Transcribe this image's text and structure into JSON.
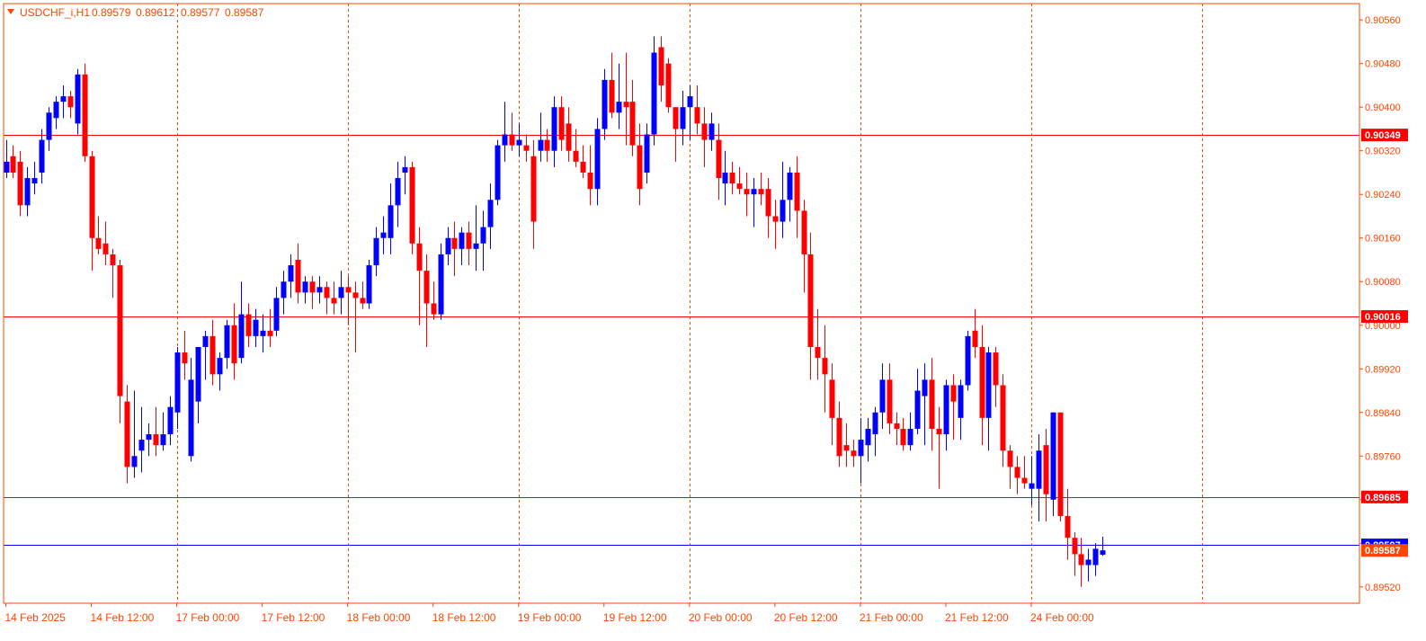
{
  "chart_data": {
    "type": "candlestick",
    "header": {
      "symbol_timeframe": "USDCHF_i,H1",
      "open": "0.89579",
      "high": "0.89612",
      "low": "0.89577",
      "close": "0.89587"
    },
    "ylim": [
      0.8949,
      0.9059
    ],
    "y_ticks": [
      "0.90560",
      "0.90480",
      "0.90400",
      "0.90320",
      "0.90240",
      "0.90160",
      "0.90080",
      "0.90000",
      "0.89920",
      "0.89840",
      "0.89760",
      "0.89680",
      "0.89600",
      "0.89520"
    ],
    "x_ticks": [
      {
        "label": "14 Feb 2025",
        "bar": 0
      },
      {
        "label": "14 Feb 12:00",
        "bar": 12
      },
      {
        "label": "17 Feb 00:00",
        "bar": 24
      },
      {
        "label": "17 Feb 12:00",
        "bar": 36
      },
      {
        "label": "18 Feb 00:00",
        "bar": 48
      },
      {
        "label": "18 Feb 12:00",
        "bar": 60
      },
      {
        "label": "19 Feb 00:00",
        "bar": 72
      },
      {
        "label": "19 Feb 12:00",
        "bar": 84
      },
      {
        "label": "20 Feb 00:00",
        "bar": 96
      },
      {
        "label": "20 Feb 12:00",
        "bar": 108
      },
      {
        "label": "21 Feb 00:00",
        "bar": 120
      },
      {
        "label": "21 Feb 12:00",
        "bar": 132
      },
      {
        "label": "24 Feb 00:00",
        "bar": 144
      }
    ],
    "period_separators": [
      24,
      48,
      72,
      96,
      120,
      144,
      168
    ],
    "horizontal_levels": [
      {
        "value": 0.90349,
        "label": "0.90349",
        "color": "#ff0000"
      },
      {
        "value": 0.90016,
        "label": "0.90016",
        "color": "#ff0000"
      },
      {
        "value": 0.89685,
        "label": "0.89685",
        "color": "#ff0000"
      }
    ],
    "bid_line": {
      "value": 0.89597,
      "label": "0.89597",
      "color": "#0000ff"
    },
    "current_price": {
      "value": 0.89587,
      "label": "0.89587",
      "color": "#ff4500"
    },
    "colors": {
      "bull": "#0000ff",
      "bear": "#ff0000",
      "grid": "#ff4500",
      "axis_text": "#ff4500",
      "frame": "#ff4500",
      "background": "#ffffff"
    },
    "candles": [
      [
        0.9028,
        0.9034,
        0.9027,
        0.903
      ],
      [
        0.9031,
        0.9033,
        0.9027,
        0.9028
      ],
      [
        0.903,
        0.9032,
        0.902,
        0.9022
      ],
      [
        0.9022,
        0.9029,
        0.902,
        0.9027
      ],
      [
        0.9026,
        0.903,
        0.9024,
        0.9027
      ],
      [
        0.9028,
        0.9036,
        0.9026,
        0.9034
      ],
      [
        0.9034,
        0.904,
        0.9032,
        0.9039
      ],
      [
        0.9038,
        0.9042,
        0.9036,
        0.9041
      ],
      [
        0.9041,
        0.9044,
        0.9038,
        0.9042
      ],
      [
        0.9042,
        0.9043,
        0.9038,
        0.904
      ],
      [
        0.9037,
        0.9047,
        0.9035,
        0.9046
      ],
      [
        0.9046,
        0.9048,
        0.903,
        0.9031
      ],
      [
        0.9031,
        0.9032,
        0.901,
        0.9016
      ],
      [
        0.9016,
        0.902,
        0.9013,
        0.9014
      ],
      [
        0.9015,
        0.9019,
        0.9011,
        0.9013
      ],
      [
        0.9013,
        0.9014,
        0.9005,
        0.9011
      ],
      [
        0.9011,
        0.9012,
        0.8982,
        0.8987
      ],
      [
        0.8986,
        0.8989,
        0.8971,
        0.8974
      ],
      [
        0.8974,
        0.8988,
        0.8972,
        0.8976
      ],
      [
        0.8977,
        0.8985,
        0.8973,
        0.8979
      ],
      [
        0.8979,
        0.8982,
        0.8976,
        0.898
      ],
      [
        0.898,
        0.8985,
        0.8976,
        0.8978
      ],
      [
        0.8978,
        0.8984,
        0.8977,
        0.898
      ],
      [
        0.898,
        0.8987,
        0.8978,
        0.8985
      ],
      [
        0.8984,
        0.8996,
        0.8981,
        0.8995
      ],
      [
        0.8995,
        0.8999,
        0.899,
        0.8993
      ],
      [
        0.8976,
        0.8994,
        0.8975,
        0.899
      ],
      [
        0.8986,
        0.8994,
        0.8982,
        0.8996
      ],
      [
        0.8996,
        0.8999,
        0.899,
        0.8998
      ],
      [
        0.8998,
        0.9001,
        0.8989,
        0.8991
      ],
      [
        0.8991,
        0.8995,
        0.8988,
        0.8994
      ],
      [
        0.8994,
        0.9001,
        0.8992,
        0.9
      ],
      [
        0.9,
        0.9004,
        0.899,
        0.8993
      ],
      [
        0.8994,
        0.9008,
        0.8993,
        0.9002
      ],
      [
        0.9002,
        0.9004,
        0.8996,
        0.8998
      ],
      [
        0.8998,
        0.9003,
        0.8996,
        0.9001
      ],
      [
        0.8998,
        0.9002,
        0.8995,
        0.8999
      ],
      [
        0.8999,
        0.9003,
        0.8996,
        0.8998
      ],
      [
        0.8999,
        0.9007,
        0.8998,
        0.9005
      ],
      [
        0.9005,
        0.901,
        0.9002,
        0.9008
      ],
      [
        0.9008,
        0.9013,
        0.9005,
        0.9011
      ],
      [
        0.9012,
        0.9015,
        0.9004,
        0.9006
      ],
      [
        0.9006,
        0.9009,
        0.9004,
        0.9008
      ],
      [
        0.9008,
        0.9009,
        0.9003,
        0.9006
      ],
      [
        0.9006,
        0.9009,
        0.9004,
        0.9007
      ],
      [
        0.9007,
        0.9008,
        0.9002,
        0.9005
      ],
      [
        0.9005,
        0.9008,
        0.9002,
        0.9004
      ],
      [
        0.9005,
        0.901,
        0.9002,
        0.9007
      ],
      [
        0.9007,
        0.9009,
        0.9,
        0.9006
      ],
      [
        0.9006,
        0.9008,
        0.8995,
        0.9005
      ],
      [
        0.9005,
        0.9008,
        0.9003,
        0.9004
      ],
      [
        0.9004,
        0.9012,
        0.9003,
        0.9011
      ],
      [
        0.9011,
        0.9018,
        0.9009,
        0.9016
      ],
      [
        0.9016,
        0.902,
        0.9013,
        0.9017
      ],
      [
        0.9016,
        0.9026,
        0.9013,
        0.9022
      ],
      [
        0.9022,
        0.903,
        0.9018,
        0.9027
      ],
      [
        0.9028,
        0.9031,
        0.9024,
        0.9029
      ],
      [
        0.9029,
        0.903,
        0.9013,
        0.9015
      ],
      [
        0.9015,
        0.9018,
        0.9,
        0.901
      ],
      [
        0.901,
        0.9013,
        0.8996,
        0.9004
      ],
      [
        0.9004,
        0.9008,
        0.9001,
        0.9002
      ],
      [
        0.9002,
        0.9015,
        0.9001,
        0.9013
      ],
      [
        0.9013,
        0.9018,
        0.9011,
        0.9016
      ],
      [
        0.9016,
        0.9019,
        0.9009,
        0.9014
      ],
      [
        0.9014,
        0.9018,
        0.9011,
        0.9017
      ],
      [
        0.9017,
        0.9019,
        0.9011,
        0.9014
      ],
      [
        0.9014,
        0.9022,
        0.901,
        0.9015
      ],
      [
        0.9015,
        0.9021,
        0.901,
        0.9018
      ],
      [
        0.9018,
        0.9026,
        0.9014,
        0.9023
      ],
      [
        0.9023,
        0.9034,
        0.9022,
        0.9033
      ],
      [
        0.9033,
        0.9041,
        0.903,
        0.9035
      ],
      [
        0.9035,
        0.9039,
        0.9032,
        0.9033
      ],
      [
        0.9033,
        0.9037,
        0.9031,
        0.9034
      ],
      [
        0.9033,
        0.9035,
        0.903,
        0.9032
      ],
      [
        0.9031,
        0.9034,
        0.9014,
        0.9019
      ],
      [
        0.9032,
        0.9039,
        0.903,
        0.9034
      ],
      [
        0.9034,
        0.9036,
        0.903,
        0.9032
      ],
      [
        0.9032,
        0.9042,
        0.9029,
        0.904
      ],
      [
        0.904,
        0.9042,
        0.9032,
        0.9034
      ],
      [
        0.9037,
        0.904,
        0.903,
        0.9032
      ],
      [
        0.9032,
        0.9036,
        0.9029,
        0.903
      ],
      [
        0.903,
        0.9033,
        0.9027,
        0.9028
      ],
      [
        0.9028,
        0.9033,
        0.9022,
        0.9025
      ],
      [
        0.9025,
        0.9038,
        0.9022,
        0.9036
      ],
      [
        0.9036,
        0.9047,
        0.9034,
        0.9045
      ],
      [
        0.9045,
        0.905,
        0.9038,
        0.9039
      ],
      [
        0.9039,
        0.9048,
        0.9036,
        0.9041
      ],
      [
        0.9041,
        0.905,
        0.9033,
        0.904
      ],
      [
        0.9041,
        0.9045,
        0.9031,
        0.9033
      ],
      [
        0.9033,
        0.9037,
        0.9022,
        0.9025
      ],
      [
        0.9028,
        0.9037,
        0.9026,
        0.9035
      ],
      [
        0.9035,
        0.9053,
        0.9033,
        0.905
      ],
      [
        0.9051,
        0.9053,
        0.9041,
        0.9044
      ],
      [
        0.9048,
        0.9049,
        0.9039,
        0.904
      ],
      [
        0.904,
        0.9039,
        0.903,
        0.9036
      ],
      [
        0.9036,
        0.9043,
        0.9033,
        0.904
      ],
      [
        0.904,
        0.9044,
        0.9034,
        0.9042
      ],
      [
        0.904,
        0.9044,
        0.9035,
        0.9037
      ],
      [
        0.9037,
        0.904,
        0.9029,
        0.9034
      ],
      [
        0.9034,
        0.9039,
        0.9032,
        0.9037
      ],
      [
        0.9034,
        0.9037,
        0.9023,
        0.9027
      ],
      [
        0.9026,
        0.9032,
        0.9022,
        0.9028
      ],
      [
        0.9028,
        0.903,
        0.9024,
        0.9026
      ],
      [
        0.9026,
        0.9029,
        0.9024,
        0.9025
      ],
      [
        0.9025,
        0.9028,
        0.902,
        0.9024
      ],
      [
        0.9024,
        0.9027,
        0.9018,
        0.9025
      ],
      [
        0.9025,
        0.9028,
        0.9022,
        0.9024
      ],
      [
        0.9025,
        0.9027,
        0.9016,
        0.902
      ],
      [
        0.902,
        0.9023,
        0.9014,
        0.9019
      ],
      [
        0.9019,
        0.903,
        0.9016,
        0.9023
      ],
      [
        0.9023,
        0.9029,
        0.9019,
        0.9028
      ],
      [
        0.9028,
        0.9031,
        0.9016,
        0.9021
      ],
      [
        0.9021,
        0.9023,
        0.9006,
        0.9013
      ],
      [
        0.9013,
        0.9017,
        0.899,
        0.8996
      ],
      [
        0.8996,
        0.9003,
        0.899,
        0.8994
      ],
      [
        0.8994,
        0.9,
        0.8984,
        0.8991
      ],
      [
        0.899,
        0.8993,
        0.8978,
        0.8983
      ],
      [
        0.8983,
        0.8986,
        0.8974,
        0.8976
      ],
      [
        0.8978,
        0.8982,
        0.8974,
        0.8977
      ],
      [
        0.8977,
        0.8979,
        0.8974,
        0.8976
      ],
      [
        0.8976,
        0.8983,
        0.8971,
        0.8979
      ],
      [
        0.8978,
        0.8983,
        0.8975,
        0.8981
      ],
      [
        0.898,
        0.8985,
        0.8976,
        0.8984
      ],
      [
        0.8984,
        0.8993,
        0.8981,
        0.899
      ],
      [
        0.899,
        0.8993,
        0.898,
        0.8982
      ],
      [
        0.8982,
        0.8984,
        0.8978,
        0.8981
      ],
      [
        0.8981,
        0.8983,
        0.8977,
        0.8978
      ],
      [
        0.8978,
        0.8984,
        0.8977,
        0.8981
      ],
      [
        0.8981,
        0.8992,
        0.898,
        0.8988
      ],
      [
        0.8987,
        0.8993,
        0.8978,
        0.899
      ],
      [
        0.899,
        0.8994,
        0.8977,
        0.8981
      ],
      [
        0.8981,
        0.8985,
        0.897,
        0.898
      ],
      [
        0.898,
        0.899,
        0.8977,
        0.8989
      ],
      [
        0.8989,
        0.8991,
        0.8979,
        0.8986
      ],
      [
        0.8983,
        0.899,
        0.8979,
        0.8989
      ],
      [
        0.8989,
        0.8999,
        0.8988,
        0.8998
      ],
      [
        0.8999,
        0.9003,
        0.8994,
        0.8996
      ],
      [
        0.8996,
        0.9,
        0.8978,
        0.8983
      ],
      [
        0.8983,
        0.8996,
        0.8977,
        0.8995
      ],
      [
        0.8995,
        0.8996,
        0.8985,
        0.8989
      ],
      [
        0.8989,
        0.8991,
        0.8974,
        0.8977
      ],
      [
        0.8977,
        0.8978,
        0.897,
        0.8974
      ],
      [
        0.8974,
        0.8976,
        0.8969,
        0.8972
      ],
      [
        0.8972,
        0.8976,
        0.897,
        0.8971
      ],
      [
        0.897,
        0.8976,
        0.8967,
        0.8971
      ],
      [
        0.897,
        0.898,
        0.8964,
        0.8977
      ],
      [
        0.8978,
        0.8981,
        0.8964,
        0.8969
      ],
      [
        0.8968,
        0.8984,
        0.8965,
        0.8984
      ],
      [
        0.8984,
        0.8983,
        0.8964,
        0.8965
      ],
      [
        0.8965,
        0.897,
        0.8957,
        0.8961
      ],
      [
        0.8961,
        0.8962,
        0.8954,
        0.8958
      ],
      [
        0.8958,
        0.8961,
        0.8952,
        0.8956
      ],
      [
        0.8956,
        0.8959,
        0.8953,
        0.8957
      ],
      [
        0.8956,
        0.896,
        0.8954,
        0.8959
      ],
      [
        0.89579,
        0.89612,
        0.89577,
        0.89587
      ]
    ]
  }
}
